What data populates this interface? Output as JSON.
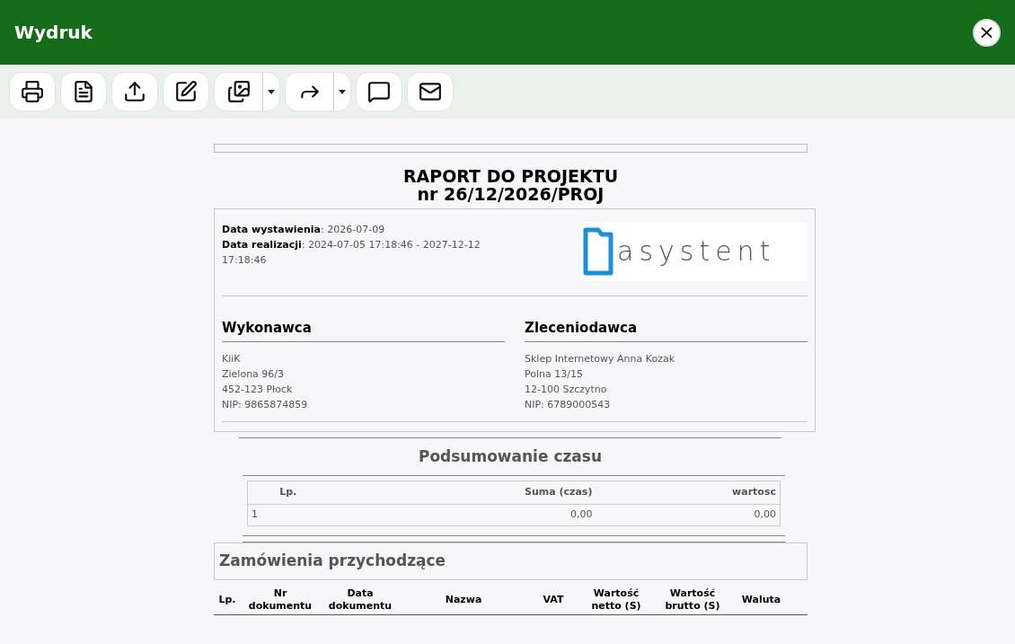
{
  "window": {
    "title": "Wydruk",
    "close": "×"
  },
  "toolbar": [
    {
      "kind": "print",
      "split": false
    },
    {
      "kind": "pdf",
      "split": false
    },
    {
      "kind": "upload",
      "split": false
    },
    {
      "kind": "edit",
      "split": false
    },
    {
      "kind": "images",
      "split": true
    },
    {
      "kind": "share",
      "split": true
    },
    {
      "kind": "comment",
      "split": false
    },
    {
      "kind": "mail",
      "split": false
    }
  ],
  "report": {
    "title": "RAPORT DO PROJEKTU",
    "number": "nr 26/12/2026/PROJ",
    "dates": [
      {
        "label": "Data wystawienia",
        "separator": ":",
        "value": "2026-07-09"
      },
      {
        "label": "Data realizacji",
        "separator": ":",
        "value": "2024-07-05 17:18:46 - 2027-12-12 17:18:46"
      }
    ],
    "logo_text": "asystent",
    "parties": [
      {
        "heading": "Wykonawca",
        "lines": [
          "KiiK",
          "Zielona 96/3",
          "452-123 Płock",
          "NIP: 9865874859"
        ]
      },
      {
        "heading": "Zleceniodawca",
        "lines": [
          "Sklep Internetowy Anna Kozak",
          "Polna 13/15",
          "12-100 Szczytno",
          "NIP: 6789000543"
        ]
      }
    ],
    "summary": {
      "title": "Podsumowanie czasu",
      "columns": [
        "Lp.",
        "Suma (czas)",
        "wartosc"
      ],
      "rows": [
        [
          "1",
          "0,00",
          "0,00"
        ]
      ]
    },
    "orders": {
      "title": "Zamówienia przychodzące",
      "columns": [
        "Lp.",
        "Nr dokumentu",
        "Data dokumentu",
        "Nazwa",
        "VAT",
        "Wartość netto (S)",
        "Wartość brutto (S)",
        "Waluta"
      ]
    }
  }
}
